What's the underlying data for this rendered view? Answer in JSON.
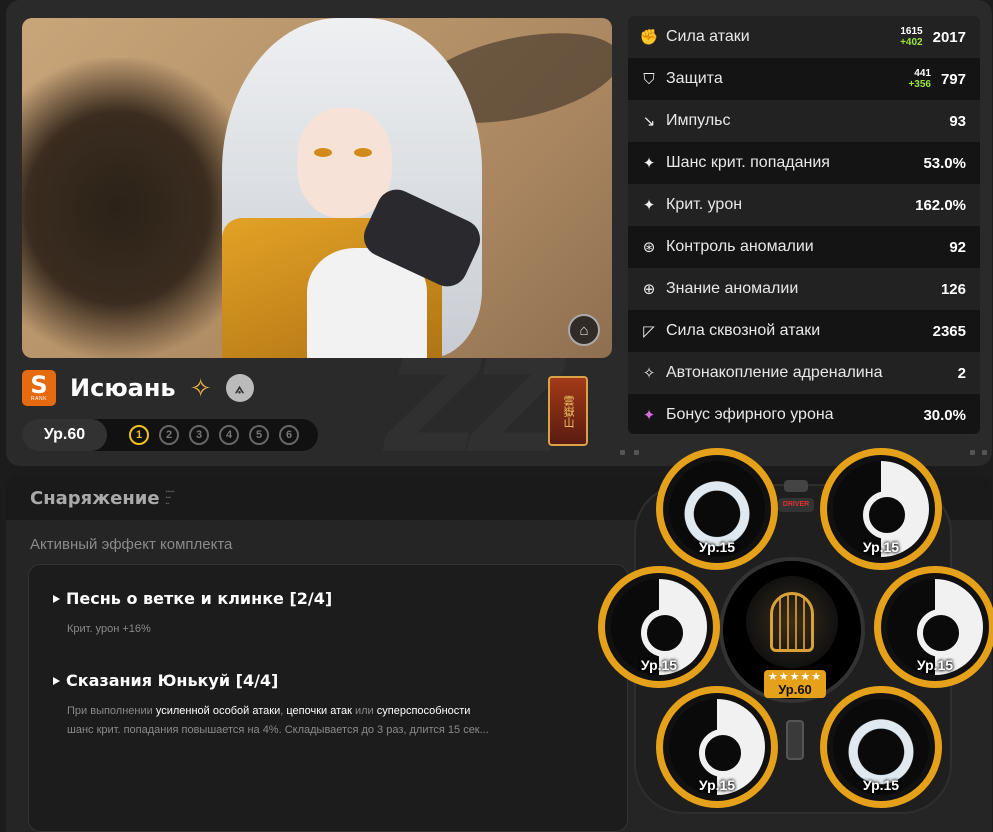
{
  "character": {
    "rank": "S",
    "rank_sub": "RANK",
    "name": "Исюань",
    "level": "Ур.60",
    "mindscape": [
      "1",
      "2",
      "3",
      "4",
      "5",
      "6"
    ],
    "mindscape_active": 1,
    "attribute_icon": "ether-attribute-icon",
    "faction_icon": "faction-icon",
    "bangboo_text": "雲嶽山"
  },
  "stats": [
    {
      "icon": "fist-icon",
      "label": "Сила атаки",
      "base": "1615",
      "add": "+402",
      "value": "2017"
    },
    {
      "icon": "shield-icon",
      "label": "Защита",
      "base": "441",
      "add": "+356",
      "value": "797"
    },
    {
      "icon": "impulse-icon",
      "label": "Импульс",
      "value": "93"
    },
    {
      "icon": "crit-rate-icon",
      "label": "Шанс крит. попадания",
      "value": "53.0%"
    },
    {
      "icon": "crit-dmg-icon",
      "label": "Крит. урон",
      "value": "162.0%"
    },
    {
      "icon": "anomaly-control-icon",
      "label": "Контроль аномалии",
      "value": "92"
    },
    {
      "icon": "anomaly-knowledge-icon",
      "label": "Знание аномалии",
      "value": "126"
    },
    {
      "icon": "pierce-icon",
      "label": "Сила сквозной атаки",
      "value": "2365"
    },
    {
      "icon": "adrenaline-icon",
      "label": "Автонакопление адреналина",
      "value": "2"
    },
    {
      "icon": "ether-dmg-icon",
      "label": "Бонус эфирного урона",
      "value": "30.0%"
    }
  ],
  "equipment": {
    "title": "Снаряжение",
    "active_set_label": "Активный эффект комплекта",
    "sets": [
      {
        "name": "Песнь о ветке и клинке [2/4]",
        "desc": "Крит. урон +16%"
      },
      {
        "name": "Сказания Юнькуй [4/4]",
        "desc_parts": [
          "При выполнении ",
          "усиленной особой атаки",
          ", ",
          "цепочки атак",
          " или ",
          "суперспособности"
        ],
        "desc_line2": "шанс крит. попадания повышается на 4%. Складывается до 3 раз, длится 15 сек..."
      }
    ]
  },
  "wheel": {
    "driver_tag": "DRIVER",
    "engine_level": "Ур.60",
    "engine_stars": "★★★★★",
    "discs": [
      {
        "slot": 1,
        "level": "Ур.15",
        "style": "face"
      },
      {
        "slot": 2,
        "level": "Ур.15",
        "style": "yin"
      },
      {
        "slot": 3,
        "level": "Ур.15",
        "style": "yin"
      },
      {
        "slot": 4,
        "level": "Ур.15",
        "style": "face"
      },
      {
        "slot": 5,
        "level": "Ур.15",
        "style": "yin"
      },
      {
        "slot": 6,
        "level": "Ур.15",
        "style": "yin"
      }
    ]
  },
  "colors": {
    "accent": "#e6a11b",
    "rank": "#e56a10",
    "bonus": "#9be23c",
    "ether": "#d66be0"
  }
}
